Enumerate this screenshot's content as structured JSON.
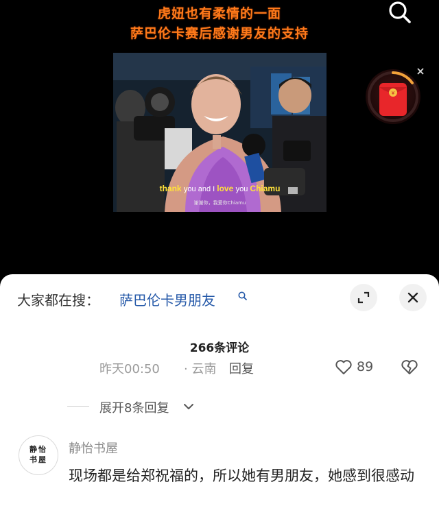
{
  "video": {
    "title_line1": "虎妞也有柔情的一面",
    "title_line2": "萨巴伦卡赛后感谢男友的支持",
    "caption_en_pre": "thank ",
    "caption_en_you1": "you and I ",
    "caption_en_love": "love ",
    "caption_en_you2": "you ",
    "caption_en_name": "Chiamu",
    "caption_zh": "谢谢你，我爱你Chiamu"
  },
  "icons": {
    "search": "search-icon",
    "red_packet": "red-envelope-icon",
    "close": "close-icon",
    "expand": "expand-icon",
    "like": "heart-icon",
    "dislike": "broken-heart-icon",
    "chevron": "chevron-down-icon"
  },
  "colors": {
    "title_orange": "#ff7a1a",
    "link_blue": "#2458a8",
    "red_packet": "#e8262a"
  },
  "sheet": {
    "hot_search_prefix": "大家都在搜：",
    "hot_search_query": "萨巴伦卡男朋友",
    "comment_count": "266条评论",
    "prev_comment": {
      "time": "昨天00:50",
      "location": "· 云南",
      "reply_label": "回复",
      "likes": "89"
    },
    "expand_replies": "展开8条回复",
    "comment": {
      "username": "静怡书屋",
      "avatar_chars_top": "静怡",
      "avatar_chars_bottom": "书屋",
      "text": "现场都是给郑祝福的，所以她有男朋友，她感到很感动"
    }
  }
}
